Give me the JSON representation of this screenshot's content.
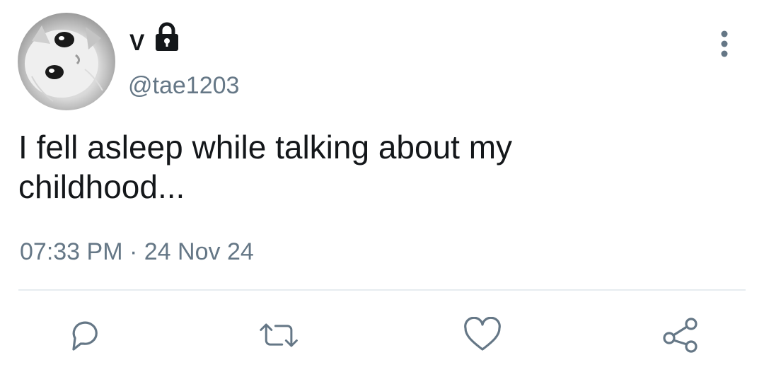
{
  "tweet": {
    "author": {
      "display_name": "V",
      "handle": "@tae1203",
      "protected_icon": "lock-icon",
      "avatar": "cat-avatar"
    },
    "text": "I fell asleep while talking about my\nchildhood...",
    "time": "07:33 PM",
    "separator": "·",
    "date": "24 Nov 24"
  },
  "actions": [
    {
      "name": "reply",
      "icon": "comment-icon"
    },
    {
      "name": "retweet",
      "icon": "retweet-icon"
    },
    {
      "name": "like",
      "icon": "heart-icon"
    },
    {
      "name": "share",
      "icon": "share-icon"
    }
  ],
  "menu_icon": "more-vertical-icon",
  "colors": {
    "text": "#14171a",
    "secondary": "#657786",
    "divider": "#e6ecf0"
  }
}
